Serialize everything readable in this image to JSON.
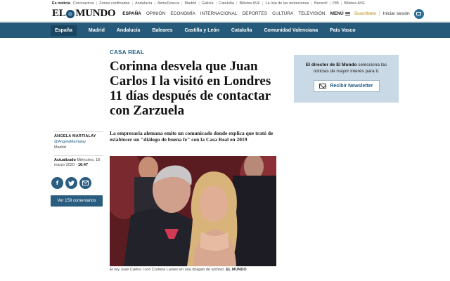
{
  "ticker": {
    "lead": "Es noticia",
    "items": [
      "Coronavirus",
      "Zonas confinadas",
      "Andalucía",
      "AstraZeneca",
      "Madrid",
      "Galicia",
      "Cataluña",
      "Billetes AVE",
      "La Isla de las tentaciones",
      "Becerril",
      "PIB",
      "Billetes AVE"
    ]
  },
  "header": {
    "logo_left": "EL",
    "logo_right": "MUNDO",
    "nav": [
      "ESPAÑA",
      "OPINIÓN",
      "ECONOMÍA",
      "INTERNACIONAL",
      "DEPORTES",
      "CULTURA",
      "TELEVISIÓN"
    ],
    "menu_label": "MENÚ",
    "subscribe_label": "Suscríbete",
    "login_label": "Iniciar sesión"
  },
  "section_nav": [
    "España",
    "Madrid",
    "Andalucía",
    "Baleares",
    "Castilla y León",
    "Cataluña",
    "Comunidad Valenciana",
    "País Vasco"
  ],
  "article": {
    "kicker": "CASA REAL",
    "headline": "Corinna desvela que Juan Carlos I la visitó en Londres 11 días después de contactar con Zarzuela",
    "subheadline": "La empresaria alemana emite un comunicado donde explica que trató de establecer un \"diálogo de buena fe\" con la Casa Real en 2019",
    "author_name": "ÁNGELA MARTIALAY",
    "author_handle": "@AngelaMartialay",
    "author_city": "Madrid",
    "updated_label": "Actualizado",
    "updated_date": "Miércoles, 18 marzo 2020 -",
    "updated_time": "16:47",
    "comments_button": "Ver 159 comentarios",
    "caption": "El rey Juan Carlos I con Corinna Larsen en una imagen de archivo.",
    "caption_credit": "EL MUNDO"
  },
  "newsletter": {
    "text_bold": "El director de El Mundo",
    "text_rest": "selecciona las noticias de mayor interés para ti.",
    "button_label": "Recibir Newsletter"
  },
  "share_icons": [
    "facebook-icon",
    "twitter-icon",
    "email-icon"
  ],
  "colors": {
    "brand_blue": "#255a7a",
    "accent_blue": "#1f5c86",
    "subscribe_gold": "#b8860b"
  }
}
